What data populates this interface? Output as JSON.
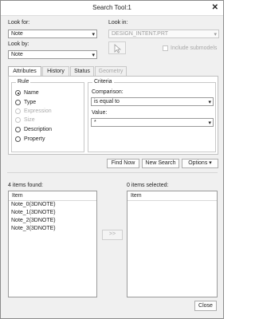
{
  "window": {
    "title": "Search Tool:1",
    "close_glyph": "✕"
  },
  "look_for": {
    "label": "Look for:",
    "value": "Note"
  },
  "look_in": {
    "label": "Look in:",
    "value": "DESIGN_INTENT.PRT"
  },
  "look_by": {
    "label": "Look by:",
    "value": "Note"
  },
  "include_submodels": {
    "label": "Include submodels",
    "checked": false
  },
  "tabs": [
    {
      "label": "Attributes",
      "active": true
    },
    {
      "label": "History"
    },
    {
      "label": "Status"
    },
    {
      "label": "Geometry",
      "disabled": true
    }
  ],
  "rule": {
    "title": "Rule",
    "options": [
      {
        "label": "Name",
        "checked": true
      },
      {
        "label": "Type"
      },
      {
        "label": "Expression",
        "disabled": true
      },
      {
        "label": "Size",
        "disabled": true
      },
      {
        "label": "Description"
      },
      {
        "label": "Property"
      }
    ]
  },
  "criteria": {
    "title": "Criteria",
    "comparison_label": "Comparison:",
    "comparison_value": "is equal to",
    "value_label": "Value:",
    "value_value": "*"
  },
  "buttons": {
    "find_now": "Find Now",
    "new_search": "New Search",
    "options": "Options",
    "transfer": ">>",
    "close": "Close"
  },
  "found": {
    "label": "4 items found:",
    "header": "Item",
    "items": [
      "Note_0(3DNOTE)",
      "Note_1(3DNOTE)",
      "Note_2(3DNOTE)",
      "Note_3(3DNOTE)"
    ]
  },
  "selected": {
    "label": "0 items selected:",
    "header": "Item"
  },
  "icons": {
    "dropdown": "▾",
    "arrow_cursor": "cursor-arrow-icon"
  }
}
